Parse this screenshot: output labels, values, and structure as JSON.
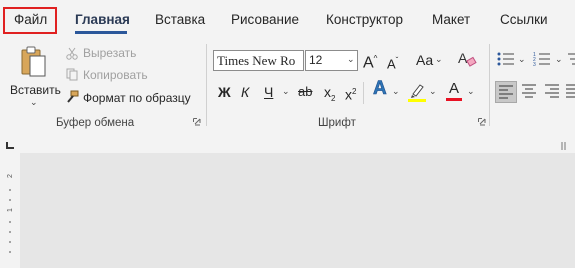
{
  "tabs": [
    {
      "label": "Файл"
    },
    {
      "label": "Главная"
    },
    {
      "label": "Вставка"
    },
    {
      "label": "Рисование"
    },
    {
      "label": "Конструктор"
    },
    {
      "label": "Макет"
    },
    {
      "label": "Ссылки"
    }
  ],
  "clipboard": {
    "paste_label": "Вставить",
    "cut_label": "Вырезать",
    "copy_label": "Копировать",
    "format_painter_label": "Формат по образцу",
    "group_label": "Буфер обмена"
  },
  "font": {
    "font_name": "Times New Ro",
    "font_size": "12",
    "bold": "Ж",
    "italic": "К",
    "underline": "Ч",
    "strikethrough": "ab",
    "subscript": "x",
    "superscript": "x",
    "text_effects": "A",
    "highlight_color": "#ffff00",
    "font_color": "#e81123",
    "group_label": "Шрифт"
  },
  "colors": {
    "accent": "#2b579a",
    "highlight_box": "#e02020"
  }
}
